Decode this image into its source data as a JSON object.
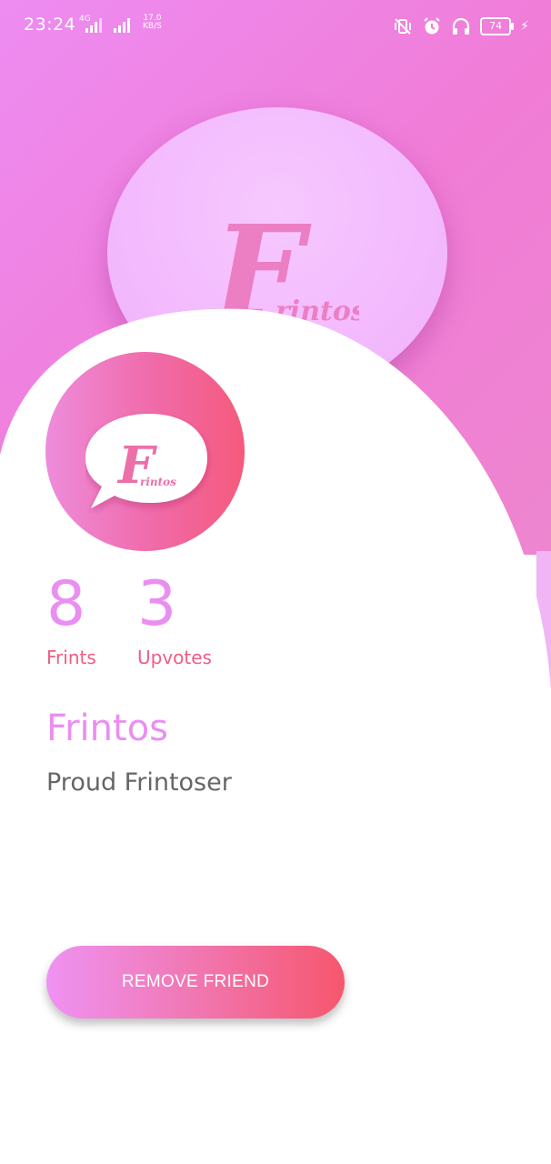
{
  "status_bar": {
    "time": "23:24",
    "network_type": "4G",
    "speed_value": "17.0",
    "speed_unit": "KB/S",
    "battery": "74"
  },
  "header": {
    "logo_initial": "F",
    "logo_text": "rintos"
  },
  "profile": {
    "avatar_logo_initial": "F",
    "avatar_logo_text": "rintos",
    "stats": [
      {
        "value": "8",
        "label": "Frints"
      },
      {
        "value": "3",
        "label": "Upvotes"
      }
    ],
    "name": "Frintos",
    "status": "Proud Frintoser"
  },
  "actions": {
    "remove_friend_label": "REMOVE FRIEND"
  },
  "colors": {
    "accent_pink": "#ea8ff2",
    "accent_red": "#f05d84",
    "button_start": "#ef92f2",
    "button_end": "#f6566d"
  }
}
